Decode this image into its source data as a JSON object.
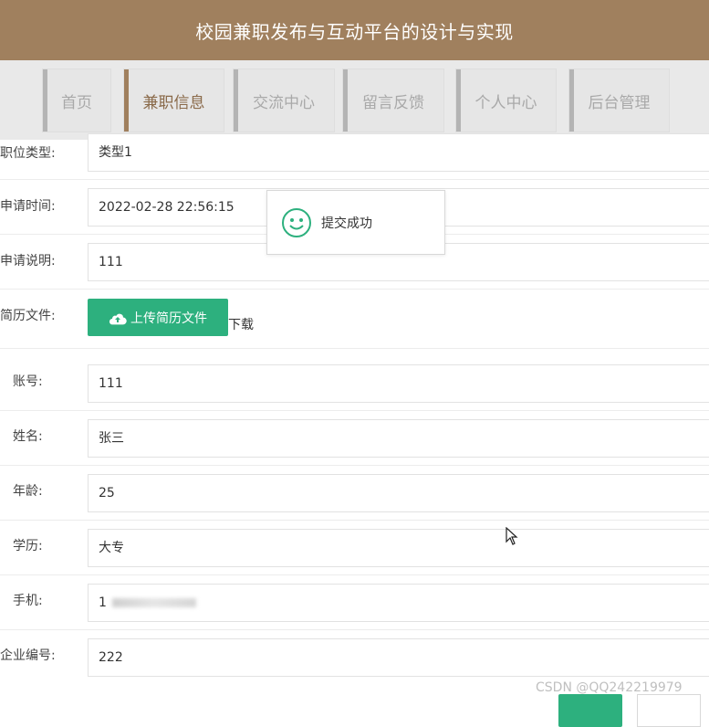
{
  "header": {
    "title": "校园兼职发布与互动平台的设计与实现"
  },
  "nav": {
    "items": [
      {
        "label": "首页"
      },
      {
        "label": "兼职信息"
      },
      {
        "label": "交流中心"
      },
      {
        "label": "留言反馈"
      },
      {
        "label": "个人中心"
      },
      {
        "label": "后台管理"
      }
    ],
    "active_label": "兼职信息"
  },
  "form": {
    "job_type": {
      "label": "职位类型:",
      "value": "类型1"
    },
    "apply_time": {
      "label": "申请时间:",
      "value": "2022-02-28 22:56:15"
    },
    "apply_desc": {
      "label": "申请说明:",
      "value": "111"
    },
    "resume": {
      "label": "简历文件:",
      "upload_label": "上传简历文件",
      "download_label": "下载"
    },
    "account": {
      "label": "账号:",
      "value": "111"
    },
    "name": {
      "label": "姓名:",
      "value": "张三"
    },
    "age": {
      "label": "年龄:",
      "value": "25"
    },
    "education": {
      "label": "学历:",
      "value": "大专"
    },
    "phone": {
      "label": "手机:",
      "value": "1"
    },
    "company_no": {
      "label": "企业编号:",
      "value": "222"
    }
  },
  "toast": {
    "message": "提交成功"
  },
  "watermark": "CSDN @QQ242219979",
  "colors": {
    "header": "#a0805e",
    "primary": "#2db07e",
    "nav_bg": "#e9e9e9"
  },
  "icons": {
    "upload": "cloud-upload-icon",
    "toast": "smile-icon",
    "cursor": "mouse-cursor-icon"
  }
}
